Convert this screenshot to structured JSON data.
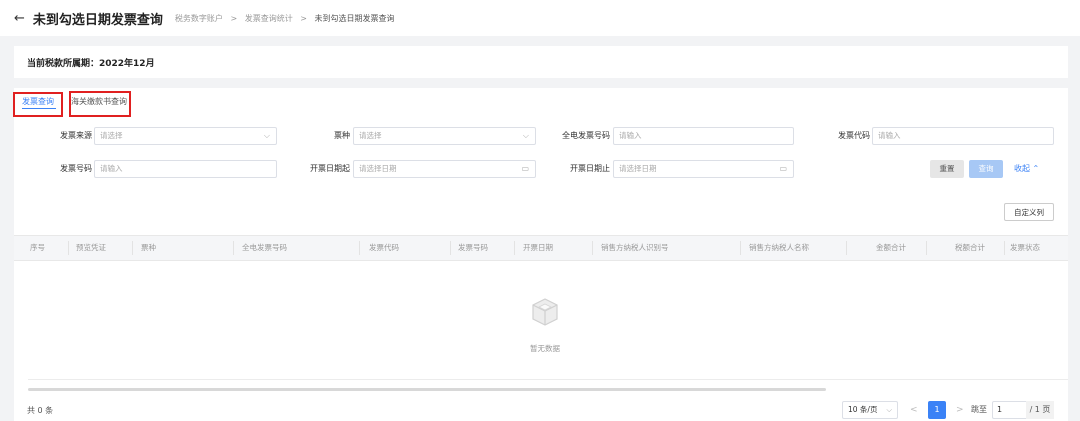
{
  "header": {
    "back_icon": "←",
    "title": "未到勾选日期发票查询",
    "breadcrumb": [
      "税务数字账户",
      "发票查询统计",
      "未到勾选日期发票查询"
    ],
    "breadcrumb_sep": ">"
  },
  "period": {
    "text": "当前税款所属期：2022年12月"
  },
  "tabs": [
    {
      "label": "发票查询",
      "active": true
    },
    {
      "label": "海关缴款书查询",
      "active": false
    }
  ],
  "filters": {
    "invoice_source": {
      "label": "发票来源",
      "placeholder": "请选择"
    },
    "ticket_type": {
      "label": "票种",
      "placeholder": "请选择"
    },
    "full_elec_no": {
      "label": "全电发票号码",
      "placeholder": "请输入"
    },
    "invoice_code": {
      "label": "发票代码",
      "placeholder": "请输入"
    },
    "invoice_no": {
      "label": "发票号码",
      "placeholder": "请输入"
    },
    "date_start": {
      "label": "开票日期起",
      "placeholder": "请选择日期"
    },
    "date_end": {
      "label": "开票日期止",
      "placeholder": "请选择日期"
    }
  },
  "buttons": {
    "reset": "重置",
    "query": "查询",
    "collapse": "收起",
    "custom_columns": "自定义列"
  },
  "table": {
    "columns": [
      "序号",
      "预览凭证",
      "票种",
      "全电发票号码",
      "发票代码",
      "发票号码",
      "开票日期",
      "销售方纳税人识别号",
      "销售方纳税人名称",
      "金额合计",
      "税额合计",
      "发票状态"
    ],
    "empty_text": "暂无数据"
  },
  "pagination": {
    "total": "共 0 条",
    "page_size": "10 条/页",
    "prev": "<",
    "current": "1",
    "next": ">",
    "jump_label": "跳至",
    "jump_value": "1",
    "total_pages": "/ 1 页"
  },
  "colors": {
    "accent": "#3b82f6",
    "highlight_box": "#e02020"
  }
}
